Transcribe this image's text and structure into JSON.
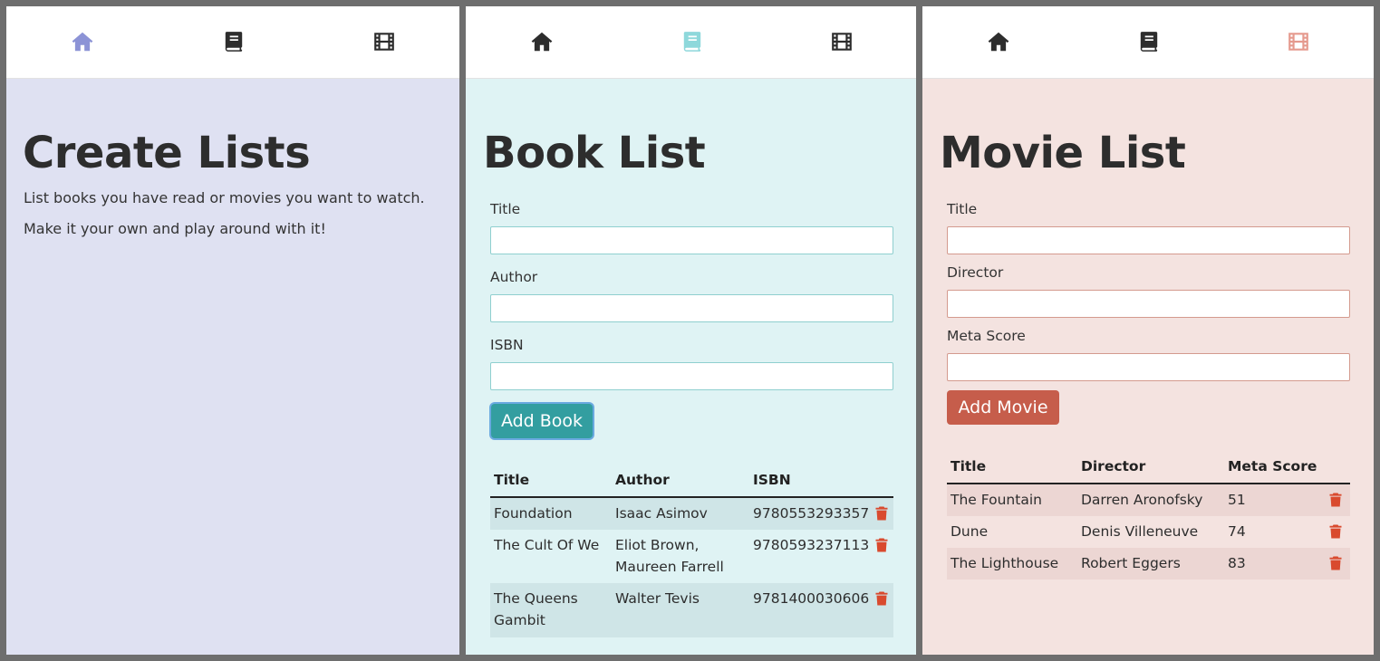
{
  "colors": {
    "home_accent": "#8c93d6",
    "book_accent": "#8ed8db",
    "movie_accent": "#e59a8e",
    "nav_dark": "#2d2d2d",
    "delete_red": "#d94a2e"
  },
  "icons": {
    "home": "house-icon",
    "books": "book-icon",
    "movies": "film-icon",
    "delete": "trash-icon"
  },
  "home": {
    "title": "Create Lists",
    "line1": "List books you have read or movies you want to watch.",
    "line2": "Make it your own and play around with it!"
  },
  "books": {
    "title": "Book List",
    "form": {
      "title_label": "Title",
      "author_label": "Author",
      "isbn_label": "ISBN",
      "title_value": "",
      "author_value": "",
      "isbn_value": "",
      "submit_label": "Add Book"
    },
    "table": {
      "headers": [
        "Title",
        "Author",
        "ISBN"
      ],
      "rows": [
        {
          "title": "Foundation",
          "author": "Isaac Asimov",
          "isbn": "9780553293357"
        },
        {
          "title": "The Cult Of We",
          "author": "Eliot Brown, Maureen Farrell",
          "isbn": "9780593237113"
        },
        {
          "title": "The Queens Gambit",
          "author": "Walter Tevis",
          "isbn": "9781400030606"
        }
      ]
    }
  },
  "movies": {
    "title": "Movie List",
    "form": {
      "title_label": "Title",
      "director_label": "Director",
      "score_label": "Meta Score",
      "title_value": "",
      "director_value": "",
      "score_value": "",
      "submit_label": "Add Movie"
    },
    "table": {
      "headers": [
        "Title",
        "Director",
        "Meta Score"
      ],
      "rows": [
        {
          "title": "The Fountain",
          "director": "Darren Aronofsky",
          "score": "51"
        },
        {
          "title": "Dune",
          "director": "Denis Villeneuve",
          "score": "74"
        },
        {
          "title": "The Lighthouse",
          "director": "Robert Eggers",
          "score": "83"
        }
      ]
    }
  }
}
